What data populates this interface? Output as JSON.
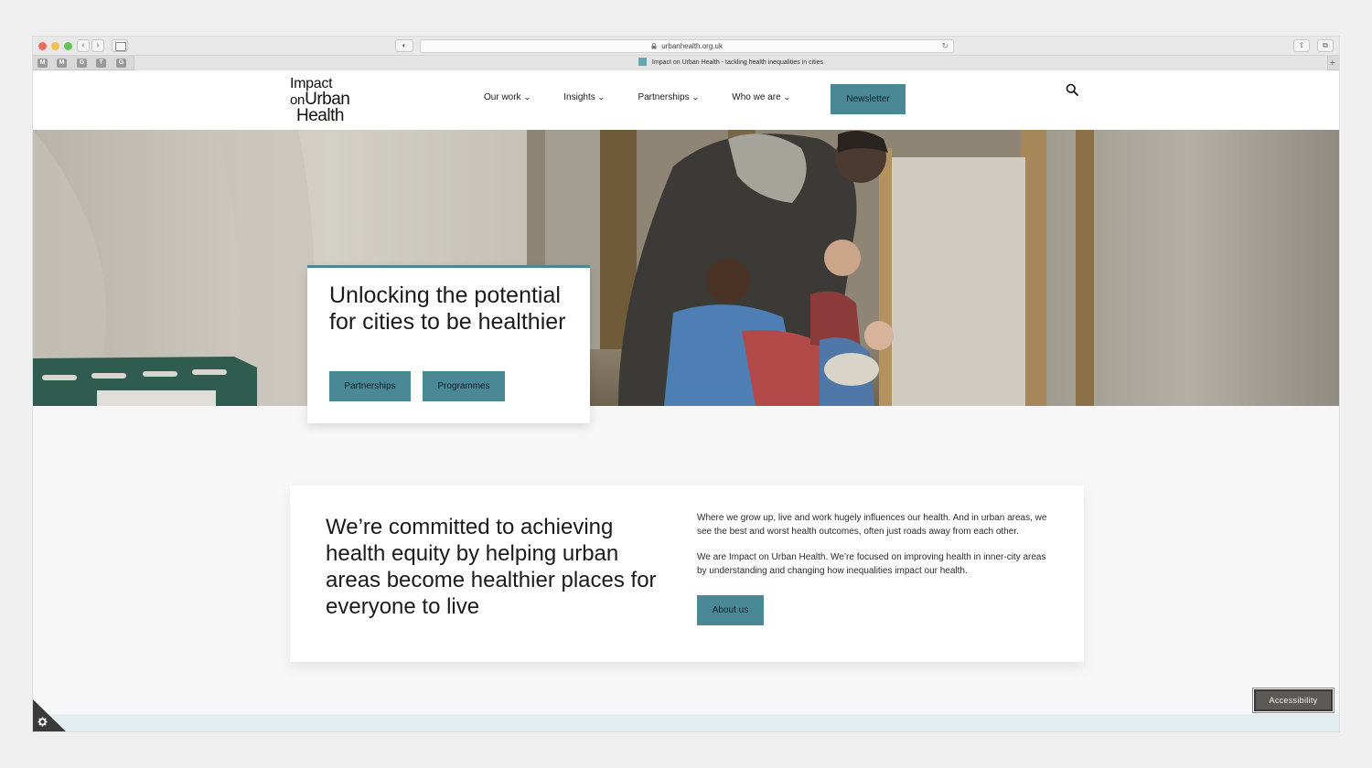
{
  "browser": {
    "url": "urbanhealth.org.uk",
    "tab_title": "Impact on Urban Health - tackling health inequalities in cities",
    "favorites": [
      "M",
      "M",
      "G",
      "T",
      "G"
    ],
    "back_glyph": "‹",
    "forward_glyph": "›",
    "privacy_glyph": "◐",
    "reload_glyph": "↻",
    "share_glyph": "⇧",
    "tabs_glyph": "⧉",
    "new_tab_glyph": "+"
  },
  "header": {
    "logo": {
      "line1": "Impact",
      "line2_prefix": "on",
      "line2_word": "Urban",
      "line3": "Health"
    },
    "nav": [
      {
        "label": "Our work"
      },
      {
        "label": "Insights"
      },
      {
        "label": "Partnerships"
      },
      {
        "label": "Who we are"
      }
    ],
    "chevron": "⌄",
    "newsletter_label": "Newsletter"
  },
  "hero": {
    "title": "Unlocking the potential for cities to be healthier",
    "buttons": [
      "Partnerships",
      "Programmes"
    ]
  },
  "mission": {
    "title": "We’re committed to achieving health equity by helping urban areas become healthier places for everyone to live",
    "paragraph1": "Where we grow up, live and work hugely influences our health. And in urban areas, we see the best and worst health outcomes, often just roads away from each other.",
    "paragraph2": "We are Impact on Urban Health. We’re focused on improving health in inner-city areas by understanding and changing how inequalities impact our health.",
    "button_label": "About us"
  },
  "accessibility": {
    "label": "Accessibility"
  },
  "colors": {
    "accent": "#4a8895",
    "footer_strip": "#e2eeef",
    "accessibility_bg": "#5c5a57"
  }
}
